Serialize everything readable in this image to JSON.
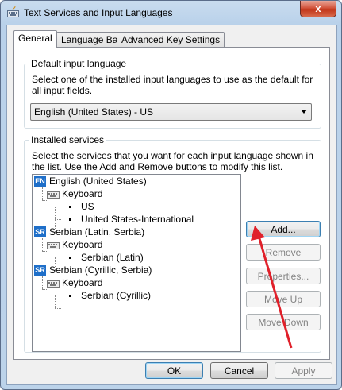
{
  "window": {
    "title": "Text Services and Input Languages",
    "close_glyph": "x"
  },
  "tabs": [
    {
      "label": "General"
    },
    {
      "label": "Language Bar"
    },
    {
      "label": "Advanced Key Settings"
    }
  ],
  "default_input": {
    "group_label": "Default input language",
    "description": "Select one of the installed input languages to use as the default for all input fields.",
    "selected_value": "English (United States) - US"
  },
  "installed_services": {
    "group_label": "Installed services",
    "description": "Select the services that you want for each input language shown in the list. Use the Add and Remove buttons to modify this list.",
    "languages": [
      {
        "badge": "EN",
        "name": "English (United States)",
        "category": "Keyboard",
        "layouts": [
          "US",
          "United States-International"
        ]
      },
      {
        "badge": "SR",
        "name": "Serbian (Latin, Serbia)",
        "category": "Keyboard",
        "layouts": [
          "Serbian (Latin)"
        ]
      },
      {
        "badge": "SR",
        "name": "Serbian (Cyrillic, Serbia)",
        "category": "Keyboard",
        "layouts": [
          "Serbian (Cyrillic)"
        ]
      }
    ],
    "buttons": {
      "add": "Add...",
      "remove": "Remove",
      "properties": "Properties...",
      "move_up": "Move Up",
      "move_down": "Move Down"
    }
  },
  "footer": {
    "ok": "OK",
    "cancel": "Cancel",
    "apply": "Apply"
  },
  "colors": {
    "annotation_arrow": "#e0202a",
    "language_badge": "#1f6fc9"
  }
}
